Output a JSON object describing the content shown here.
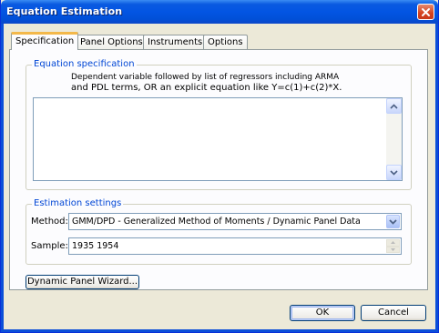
{
  "window": {
    "title": "Equation Estimation"
  },
  "tabs": [
    {
      "label": "Specification"
    },
    {
      "label": "Panel Options"
    },
    {
      "label": "Instruments"
    },
    {
      "label": "Options"
    }
  ],
  "equation_spec": {
    "legend": "Equation specification",
    "hint_line1": "Dependent variable followed by list of regressors including ARMA",
    "hint_line2": "and PDL terms, OR an explicit equation like Y=c(1)+c(2)*X.",
    "value": ""
  },
  "estimation": {
    "legend": "Estimation settings",
    "method_label": "Method:",
    "method_value": "GMM/DPD  -  Generalized Method of Moments / Dynamic Panel Data",
    "sample_label": "Sample:",
    "sample_value": "1935 1954"
  },
  "buttons": {
    "wizard": "Dynamic Panel Wizard...",
    "ok": "OK",
    "cancel": "Cancel"
  }
}
